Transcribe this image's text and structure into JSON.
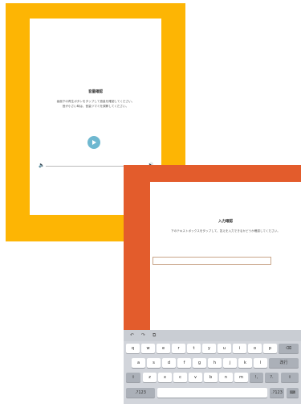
{
  "screenA": {
    "title": "音量確認",
    "instruction": "画面下の再生ボタンをタップして音量を確認してください。",
    "instruction2": "音が小さい時は、音量ツマミを調節してください。",
    "play_icon": "play-icon",
    "volume_low_icon": "speaker-low-icon",
    "volume_high_icon": "speaker-high-icon"
  },
  "screenB": {
    "title": "入力確認",
    "instruction": "下のテキストボックスをタップして、答えを入力できるかどうか確認してください。",
    "input_value": ""
  },
  "keyboard": {
    "toolbar": [
      "↶",
      "↷",
      "⧉"
    ],
    "row1": [
      "q",
      "w",
      "e",
      "r",
      "t",
      "y",
      "u",
      "i",
      "o",
      "p"
    ],
    "row2": [
      "a",
      "s",
      "d",
      "f",
      "g",
      "h",
      "j",
      "k",
      "l"
    ],
    "row3": [
      "z",
      "x",
      "c",
      "v",
      "b",
      "n",
      "m"
    ],
    "backspace": "⌫",
    "return": "改行",
    "shift": "⇧",
    "shift_right": "⇧",
    "switch": ".?123",
    "switch_right": ".?123",
    "keyboard_hide": "⌨"
  },
  "colors": {
    "tabletA": "#FDB504",
    "tabletB": "#E35C2C",
    "accent": "#6FB8D0"
  }
}
